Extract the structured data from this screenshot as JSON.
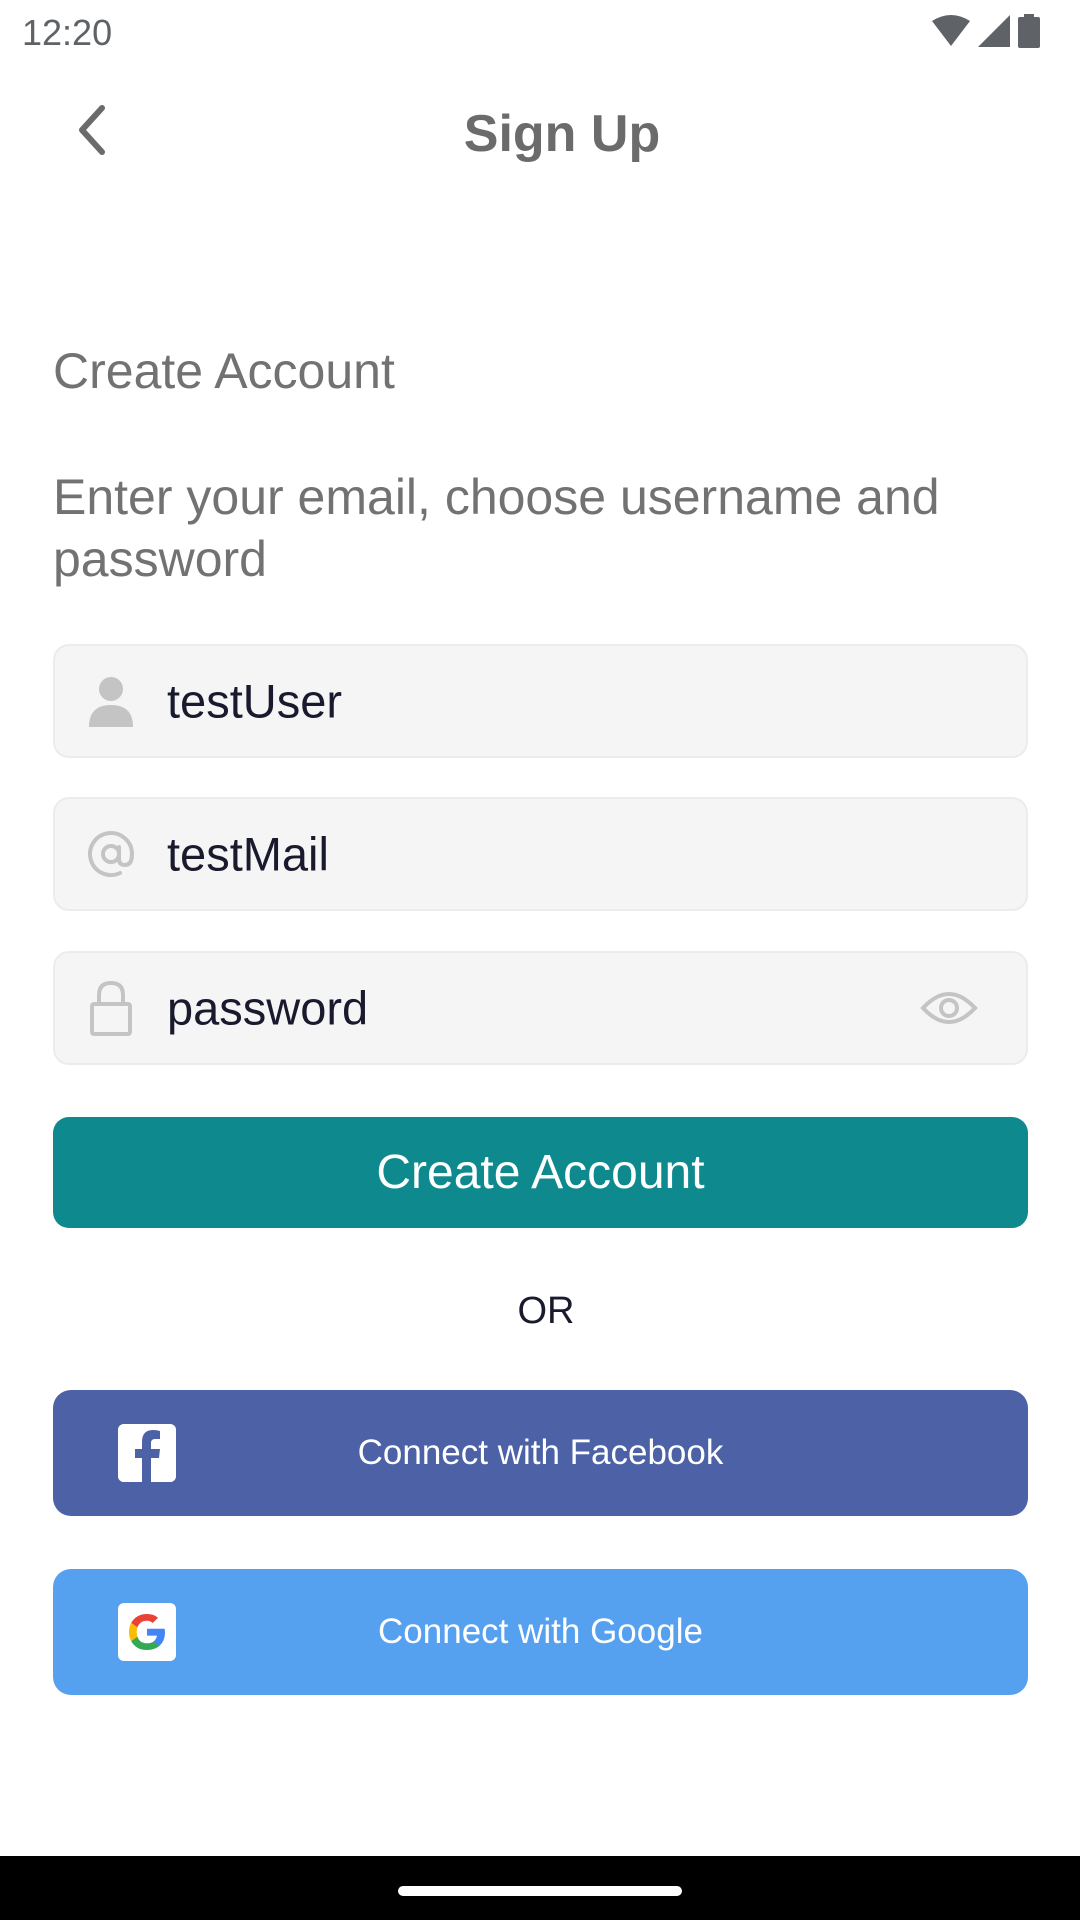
{
  "status_bar": {
    "time": "12:20",
    "icons": [
      "wifi-icon",
      "signal-icon",
      "battery-icon"
    ]
  },
  "header": {
    "title": "Sign Up",
    "back_icon": "chevron-left-icon"
  },
  "content": {
    "heading": "Create Account",
    "subheading": "Enter your email, choose username and password"
  },
  "form": {
    "username": {
      "value": "testUser",
      "icon": "person-icon"
    },
    "email": {
      "value": "testMail",
      "icon": "at-icon"
    },
    "password": {
      "value": "password",
      "icon": "lock-icon",
      "toggle_icon": "eye-icon"
    }
  },
  "actions": {
    "create_account_label": "Create Account",
    "or_label": "OR",
    "facebook_label": "Connect with Facebook",
    "google_label": "Connect with Google"
  },
  "colors": {
    "primary": "#0e8a8e",
    "facebook": "#4c61a6",
    "google": "#56a0f0",
    "field_bg": "#f5f5f5"
  }
}
